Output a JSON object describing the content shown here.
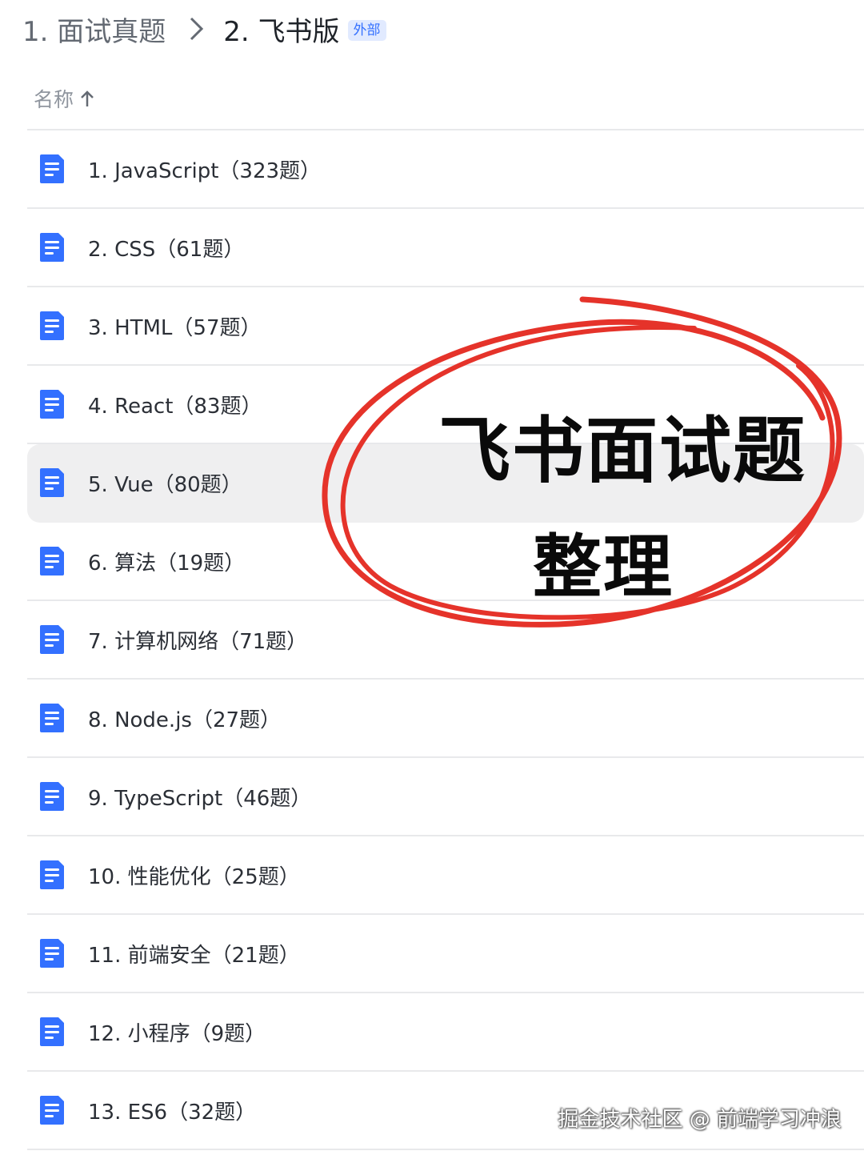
{
  "breadcrumb": {
    "parent": "1. 面试真题",
    "current": "2. 飞书版",
    "tag": "外部"
  },
  "list_header": {
    "name_label": "名称"
  },
  "items": [
    {
      "label": "1. JavaScript（323题）"
    },
    {
      "label": "2. CSS（61题）"
    },
    {
      "label": "3. HTML（57题）"
    },
    {
      "label": "4. React（83题）"
    },
    {
      "label": "5. Vue（80题）"
    },
    {
      "label": "6. 算法（19题）"
    },
    {
      "label": "7. 计算机网络（71题）"
    },
    {
      "label": "8. Node.js（27题）"
    },
    {
      "label": "9. TypeScript（46题）"
    },
    {
      "label": "10. 性能优化（25题）"
    },
    {
      "label": "11. 前端安全（21题）"
    },
    {
      "label": "12. 小程序（9题）"
    },
    {
      "label": "13. ES6（32题）"
    }
  ],
  "overlay": {
    "line1": "飞书面试题",
    "line2": "整理"
  },
  "watermark": "掘金技术社区 @ 前端学习冲浪",
  "colors": {
    "doc_icon": "#3370ff",
    "tag_bg": "#e1eaff",
    "circle": "#e5332a"
  },
  "icons": {
    "file": "doc-icon",
    "sort": "arrow-up-icon",
    "separator": "chevron-right-icon"
  }
}
